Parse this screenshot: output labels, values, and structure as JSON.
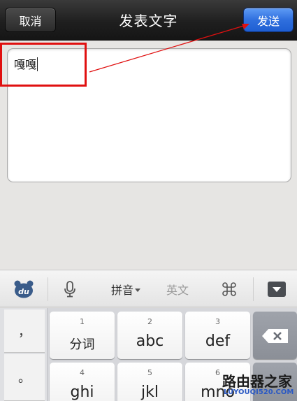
{
  "navbar": {
    "cancel_label": "取消",
    "title": "发表文字",
    "send_label": "发送"
  },
  "compose": {
    "text": "嘎嘎"
  },
  "toolbar": {
    "logo_label": "du",
    "pinyin_label": "拼音",
    "english_label": "英文"
  },
  "keyboard": {
    "left_keys": [
      "，",
      "。"
    ],
    "keys": [
      {
        "num": "1",
        "label": "分词"
      },
      {
        "num": "2",
        "label": "abc"
      },
      {
        "num": "3",
        "label": "def"
      },
      {
        "num": "4",
        "label": "ghi"
      },
      {
        "num": "5",
        "label": "jkl"
      },
      {
        "num": "6",
        "label": "mno"
      }
    ]
  },
  "watermark": {
    "cn": "路由器之家",
    "en": "LUYOUQI520.COM"
  },
  "colors": {
    "send_button": "#2f6fde",
    "annotation": "#e01010"
  }
}
